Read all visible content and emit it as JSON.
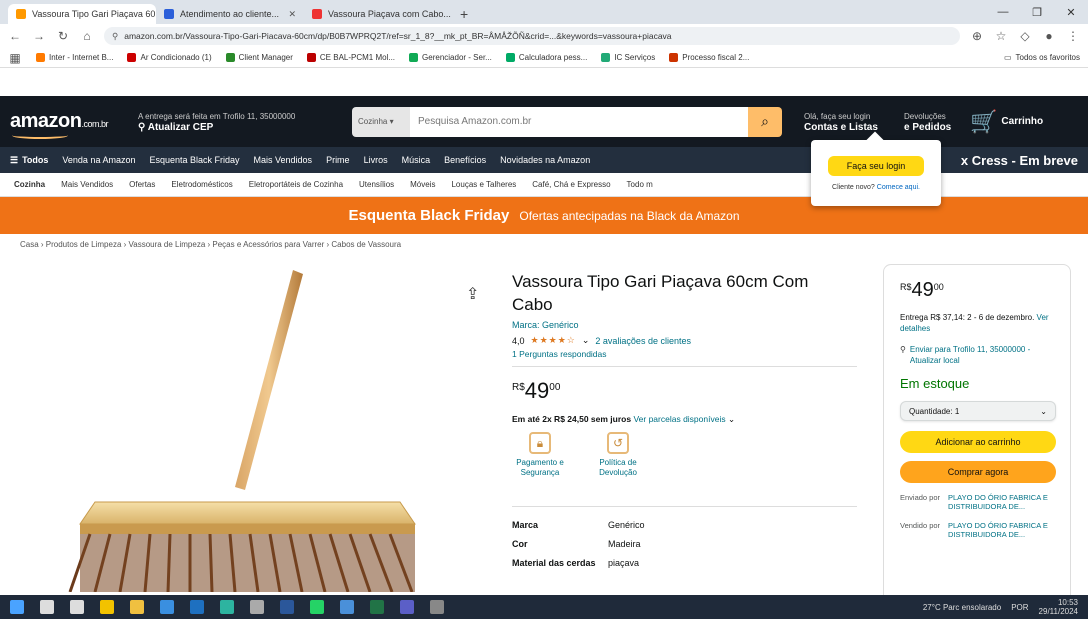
{
  "browser": {
    "tabs": [
      {
        "label": "Vassoura Tipo Gari Piaçava 60...",
        "favicon_color": "#ff9900",
        "active": true
      },
      {
        "label": "Atendimento ao cliente...",
        "favicon_color": "#2b5fd9",
        "active": false
      },
      {
        "label": "Vassoura Piaçava com Cabo...",
        "favicon_color": "#e33",
        "active": false
      }
    ],
    "new_tab": "+",
    "window_controls": [
      "—",
      "❐",
      "✕"
    ],
    "url": "amazon.com.br/Vassoura-Tipo-Gari-Piacava-60cm/dp/B0B7WPRQ2T/ref=sr_1_8?__mk_pt_BR=ÅMÅŽÕÑ&crid=...&keywords=vassoura+piacava",
    "bookmarks": [
      {
        "label": "Inter - Internet B...",
        "color": "#ff7a00"
      },
      {
        "label": "Ar Condicionado (1)",
        "color": "#c00"
      },
      {
        "label": "Client Manager",
        "color": "#2a8a2a"
      },
      {
        "label": "CE BAL-PCM1 Mol...",
        "color": "#b00"
      },
      {
        "label": "Gerenciador - Ser...",
        "color": "#1a5"
      },
      {
        "label": "Calculadora pess...",
        "color": "#0a6"
      },
      {
        "label": "IC Serviços",
        "color": "#2a7"
      },
      {
        "label": "Processo fiscal 2...",
        "color": "#c30"
      }
    ],
    "bookmarks_right": "Todos os favoritos"
  },
  "amazon": {
    "logo": "amazon",
    "logo_suffix": ".com.br",
    "deliver_line1": "A entrega será feita em Trofilo 11, 35000000",
    "deliver_line2": "Atualizar CEP",
    "search_category": "Cozinha",
    "search_placeholder": "Pesquisa Amazon.com.br",
    "account_line1": "Olá, faça seu login",
    "account_line2": "Contas e Listas",
    "orders_line1": "Devoluções",
    "orders_line2": "e Pedidos",
    "cart_label": "Carrinho",
    "nav": [
      "Todos",
      "Venda na Amazon",
      "Esquenta Black Friday",
      "Mais Vendidos",
      "Prime",
      "Livros",
      "Música",
      "Benefícios",
      "Novidades na Amazon"
    ],
    "nav_promo": "x Cress - Em breve",
    "subnav": [
      "Cozinha",
      "Mais Vendidos",
      "Ofertas",
      "Eletrodomésticos",
      "Eletroportáteis de Cozinha",
      "Utensílios",
      "Móveis",
      "Louças e Talheres",
      "Café, Chá e Expresso",
      "Todo m"
    ],
    "banner_main": "Esquenta Black Friday",
    "banner_sub": "Ofertas antecipadas na Black da Amazon",
    "breadcrumb": "Casa › Produtos de Limpeza › Vassoura de Limpeza › Peças e Acessórios para Varrer › Cabos de Vassoura",
    "popover_button": "Faça seu login",
    "popover_text": "Cliente novo?",
    "popover_link": "Comece aqui."
  },
  "product": {
    "title": "Vassoura Tipo Gari Piaçava 60cm Com Cabo",
    "brand": "Marca: Genérico",
    "rating_value": "4,0",
    "stars": "★★★★☆",
    "reviews": "2 avaliações de clientes",
    "questions": "1 Perguntas respondidas",
    "price_currency": "R$",
    "price_whole": "49",
    "price_cents": "00",
    "installments_bold": "Em até 2x R$ 24,50 sem juros",
    "installments_link": "Ver parcelas disponíveis",
    "features": [
      {
        "icon": "lock-icon",
        "glyph": "🔒",
        "label": "Pagamento e Segurança"
      },
      {
        "icon": "package-icon",
        "glyph": "📦",
        "label": "Política de Devolução"
      }
    ],
    "specs": [
      {
        "key": "Marca",
        "value": "Genérico"
      },
      {
        "key": "Cor",
        "value": "Madeira"
      },
      {
        "key": "Material das cerdas",
        "value": "piaçava"
      }
    ]
  },
  "buybox": {
    "price_currency": "R$",
    "price_whole": "49",
    "price_cents": "00",
    "shipping": "Entrega R$ 37,14: 2 - 6 de dezembro.",
    "shipping_link": "Ver detalhes",
    "location": "Enviar para Trofilo 11, 35000000 - Atualizar local",
    "stock": "Em estoque",
    "quantity": "Quantidade: 1",
    "add_to_cart": "Adicionar ao carrinho",
    "buy_now": "Comprar agora",
    "sellers": [
      {
        "key": "Enviado por",
        "value": "PLAYO DO ÓRIO FABRICA E DISTRIBUIDORA DE..."
      },
      {
        "key": "Vendido por",
        "value": "PLAYO DO ÓRIO FABRICA E DISTRIBUIDORA DE..."
      }
    ]
  },
  "taskbar": {
    "icons": [
      {
        "name": "start-icon",
        "color": "#4aa3ff"
      },
      {
        "name": "search-icon",
        "color": "#ddd"
      },
      {
        "name": "taskview-icon",
        "color": "#ddd"
      },
      {
        "name": "chrome-icon",
        "color": "#f2c200"
      },
      {
        "name": "explorer-icon",
        "color": "#f0c040"
      },
      {
        "name": "store-icon",
        "color": "#3a8fe0"
      },
      {
        "name": "mail-icon",
        "color": "#1e70c0"
      },
      {
        "name": "edge-icon",
        "color": "#2db4a0"
      },
      {
        "name": "settings-icon",
        "color": "#aaa"
      },
      {
        "name": "word-icon",
        "color": "#2b579a"
      },
      {
        "name": "whatsapp-icon",
        "color": "#25d366"
      },
      {
        "name": "app-icon",
        "color": "#4a90d9"
      },
      {
        "name": "excel-icon",
        "color": "#217346"
      },
      {
        "name": "teams-icon",
        "color": "#5b5fc7"
      },
      {
        "name": "misc-icon",
        "color": "#888"
      }
    ],
    "weather": "27°C Parc ensolarado",
    "lang": "POR",
    "time": "10:53",
    "date": "29/11/2024"
  }
}
